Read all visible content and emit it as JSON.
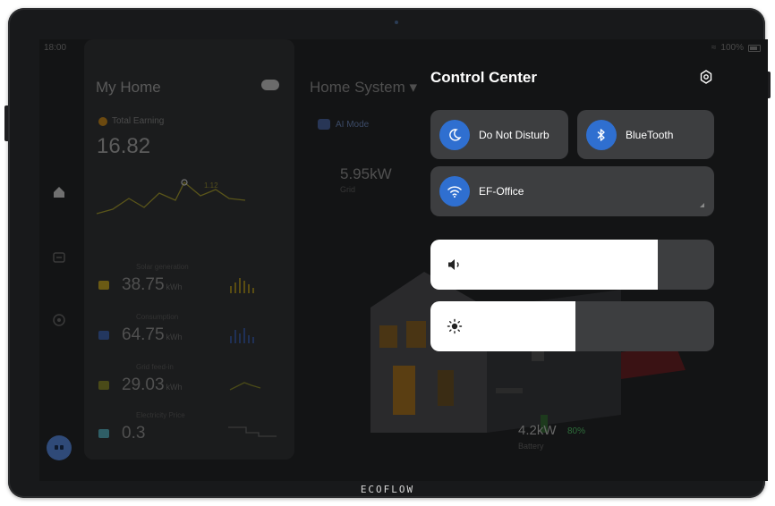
{
  "device": {
    "brand": "ECOFLOW"
  },
  "statusbar": {
    "time": "18:00",
    "battery": "100%"
  },
  "background": {
    "my_home": {
      "title": "My Home",
      "earning_label": "Total Earning",
      "earning_value": "16.82",
      "sparkline_point_label": "1.12",
      "metrics": [
        {
          "label": "Solar generation",
          "value": "38.75",
          "unit": "kWh",
          "color": "#6b5a14"
        },
        {
          "label": "Consumption",
          "value": "64.75",
          "unit": "kWh",
          "color": "#23375f"
        },
        {
          "label": "Grid feed-in",
          "value": "29.03",
          "unit": "kWh",
          "color": "#4a4a18"
        },
        {
          "label": "Electricity Price",
          "value": "0.3",
          "unit": "",
          "color": "#2f5e66"
        }
      ]
    },
    "home_system": {
      "title": "Home System",
      "ai_mode": "AI Mode",
      "grid_power": "5.95kW",
      "grid_label": "Grid",
      "battery_power": "4.2kW",
      "battery_percent": "80%",
      "battery_label": "Battery"
    }
  },
  "control_center": {
    "title": "Control Center",
    "settings_icon": "gear-icon",
    "tiles": {
      "do_not_disturb": {
        "label": "Do Not Disturb",
        "icon": "moon-icon"
      },
      "bluetooth": {
        "label": "BlueTooth",
        "icon": "bluetooth-icon"
      },
      "wifi": {
        "label": "EF-Office",
        "icon": "wifi-icon"
      }
    },
    "volume": {
      "level": 0.8,
      "icon": "speaker-icon"
    },
    "brightness": {
      "level": 0.51,
      "icon": "sun-icon"
    },
    "accent": "#2f6fd0"
  }
}
